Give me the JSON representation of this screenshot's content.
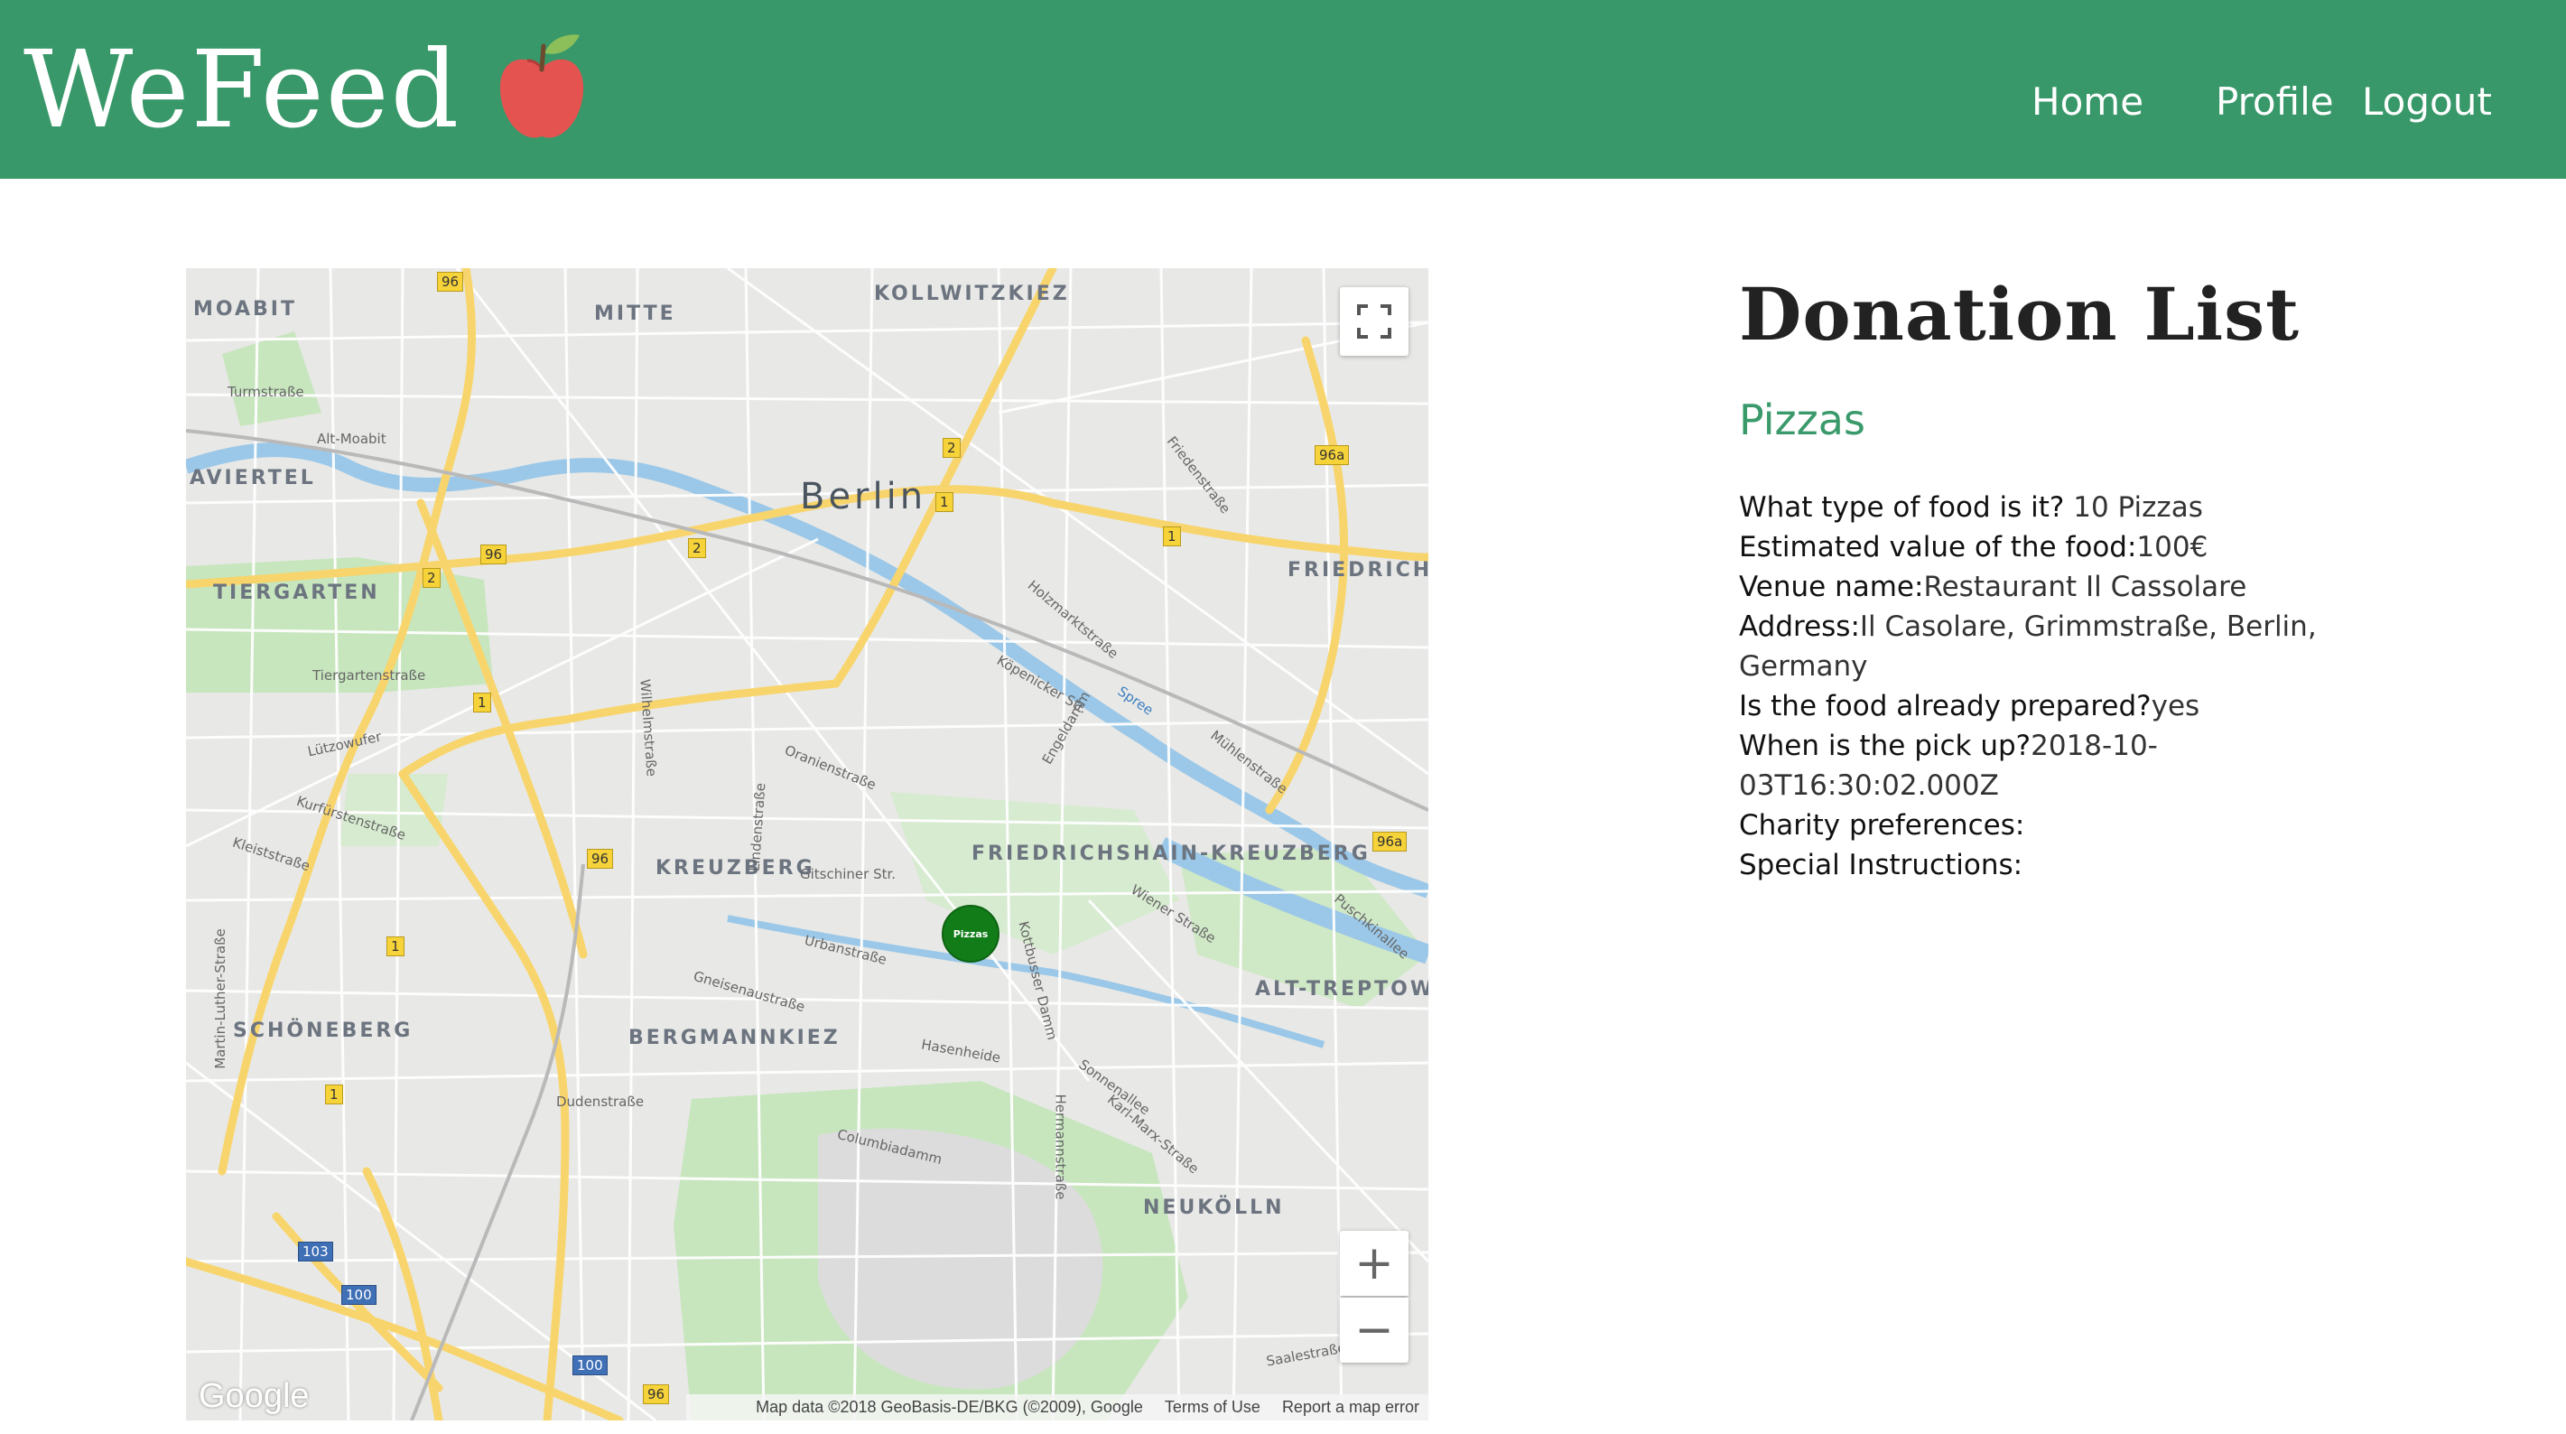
{
  "header": {
    "brand": "WeFeed",
    "brand_icon": "apple-icon",
    "nav": {
      "home": "Home",
      "profile": "Profile",
      "logout": "Logout"
    },
    "colors": {
      "bar": "#389869",
      "text": "#ffffff"
    }
  },
  "map": {
    "city_label": "Berlin",
    "districts": [
      "MOABIT",
      "MITTE",
      "KOLLWITZKIEZ",
      "AVIERTEL",
      "TIERGARTEN",
      "FRIEDRICHSH",
      "KREUZBERG",
      "FRIEDRICHSHAIN-KREUZBERG",
      "ALT-TREPTOW",
      "SCHÖNEBERG",
      "BERGMANNKIEZ",
      "NEUKÖLLN"
    ],
    "streets": [
      "Turmstraße",
      "Alt-Moabit",
      "Tiergartenstraße",
      "Lützowufer",
      "Kurfürstenstraße",
      "Kleiststraße",
      "Martin-Luther-Straße",
      "Gitschiner Str.",
      "Urbanstraße",
      "Gneisenaustraße",
      "Hasenheide",
      "Dudenstraße",
      "Columbiadamm",
      "Oranienstraße",
      "Köpenicker Str.",
      "Holzmarktstraße",
      "Engeldamm",
      "Wiener Straße",
      "Sonnenallee",
      "Karl-Marx-Straße",
      "Hermannstraße",
      "Kottbusser Damm",
      "Wilhelmstraße",
      "Lindenstraße",
      "Friedenstraße",
      "Mühlenstraße",
      "Puschkinallee",
      "Saalestraße",
      "Spree"
    ],
    "route_badges": [
      "96",
      "2",
      "96",
      "2",
      "1",
      "1",
      "96a",
      "1",
      "96",
      "1",
      "1",
      "103",
      "100",
      "100",
      "96",
      "96a",
      "2"
    ],
    "marker_label": "Pizzas",
    "google_logo": "Google",
    "attribution": {
      "data": "Map data ©2018 GeoBasis-DE/BKG (©2009), Google",
      "terms": "Terms of Use",
      "report": "Report a map error"
    },
    "controls": {
      "fullscreen_icon": "fullscreen-icon",
      "zoom_in": "+",
      "zoom_out": "−"
    }
  },
  "panel": {
    "title": "Donation List",
    "donation": {
      "name": "Pizzas",
      "details": [
        {
          "label": "What type of food is it?",
          "value": " 10 Pizzas"
        },
        {
          "label": "Estimated value of the food:",
          "value": "100€"
        },
        {
          "label": "Venue name:",
          "value": "Restaurant Il Cassolare"
        },
        {
          "label": "Address:",
          "value": "Il Casolare, Grimmstraße, Berlin, Germany"
        },
        {
          "label": "Is the food already prepared?",
          "value": "yes"
        },
        {
          "label": "When is the pick up?",
          "value": "2018-10-03T16:30:02.000Z"
        },
        {
          "label": "Charity preferences:",
          "value": ""
        },
        {
          "label": "Special Instructions:",
          "value": ""
        }
      ]
    },
    "colors": {
      "accent": "#3a9a6b"
    }
  }
}
